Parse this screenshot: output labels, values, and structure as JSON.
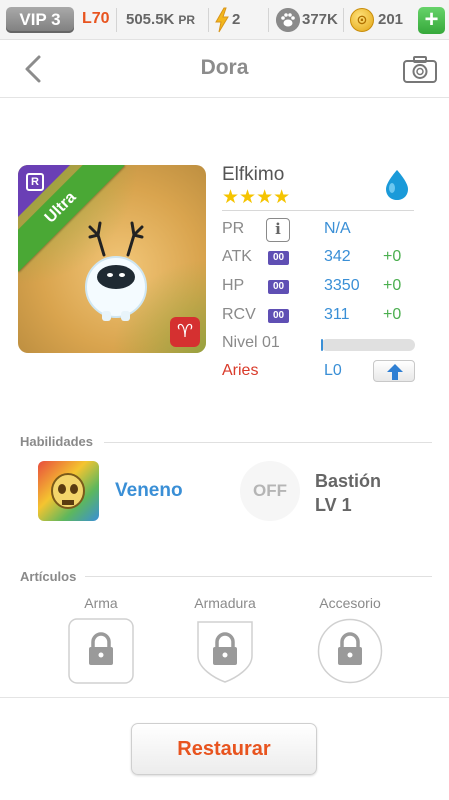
{
  "topbar": {
    "vip": "VIP 3",
    "level": "L70",
    "pr_value": "505.5K",
    "pr_suffix": "PR",
    "energy": "2",
    "paws": "377K",
    "coins": "201",
    "add_label": "+"
  },
  "header": {
    "title": "Dora"
  },
  "pet": {
    "name": "Elfkimo",
    "stars": "★★★★",
    "star_count": 4,
    "rarity": "Ultra",
    "rank": "R",
    "sign_symbol": "♈",
    "element_color": "#1a9ad9"
  },
  "stats": {
    "pr_label": "PR",
    "pr_info": "i",
    "pr_value": "N/A",
    "tag": "00",
    "atk_label": "ATK",
    "atk_value": "342",
    "atk_bonus": "+0",
    "hp_label": "HP",
    "hp_value": "3350",
    "hp_bonus": "+0",
    "rcv_label": "RCV",
    "rcv_value": "311",
    "rcv_bonus": "+0",
    "nivel_label": "Nivel 01",
    "xp_progress": 0.02,
    "sign_label": "Aries",
    "sign_level": "L0"
  },
  "skills": {
    "title": "Habilidades",
    "skill1_name": "Veneno",
    "skill2_state": "OFF",
    "skill2_name": "Bastión",
    "skill2_level": "LV 1"
  },
  "items": {
    "title": "Artículos",
    "slot1": "Arma",
    "slot2": "Armadura",
    "slot3": "Accesorio"
  },
  "footer": {
    "restore_label": "Restaurar"
  },
  "colors": {
    "accent_orange": "#e8541f",
    "stat_blue": "#3a8fd6",
    "bonus_green": "#4caf50",
    "aries_red": "#d93a2a"
  }
}
